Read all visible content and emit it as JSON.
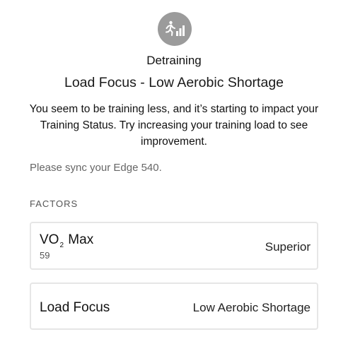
{
  "status": {
    "icon": "training-status-icon",
    "icon_color": "#9b9b9b",
    "title": "Detraining",
    "subtitle": "Load Focus - Low Aerobic Shortage",
    "description": "You seem to be training less, and it’s starting to impact your Training Status. Try increasing your training load to see improvement."
  },
  "sync_note": "Please sync your Edge 540.",
  "factors": {
    "heading": "FACTORS",
    "vo2max": {
      "label_main": "VO",
      "label_sub": "2",
      "label_tail": "Max",
      "value": "59",
      "rating": "Superior"
    },
    "load_focus": {
      "label": "Load Focus",
      "rating": "Low Aerobic Shortage"
    }
  }
}
